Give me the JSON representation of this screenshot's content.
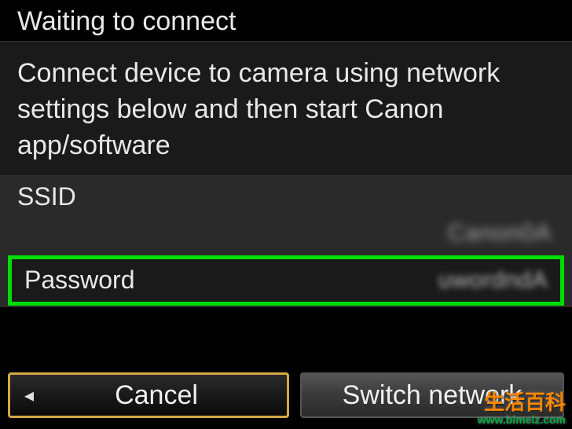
{
  "title": "Waiting to connect",
  "instruction": "Connect device to camera using network settings below and then start Canon app/software",
  "fields": {
    "ssid_label": "SSID",
    "ssid_value": "Canon0A",
    "password_label": "Password",
    "password_value": "uwordndA"
  },
  "buttons": {
    "cancel": "Cancel",
    "switch": "Switch network"
  },
  "watermark": {
    "line1": "生活百科",
    "line2": "www.bimeiz.com"
  }
}
